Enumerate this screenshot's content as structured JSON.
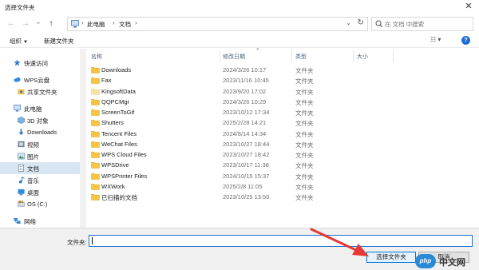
{
  "window": {
    "title": "选择文件夹",
    "close_glyph": "✕"
  },
  "address": {
    "back_glyph": "←",
    "forward_glyph": "→",
    "recent_glyph": "⌄",
    "up_glyph": "↑",
    "crumbs": [
      "此电脑",
      "文档"
    ],
    "sep_glyph": "›",
    "dropdown_glyph": "⌄",
    "refresh_glyph": "↻"
  },
  "search": {
    "placeholder": "在 文档 中搜索"
  },
  "toolbar": {
    "organize_label": "组织",
    "new_folder_label": "新建文件夹",
    "caret_glyph": "▼",
    "view_glyph": "☷ ▾",
    "help_glyph": "?"
  },
  "sidebar": {
    "items": [
      {
        "label": "快速访问",
        "icon": "star-icon"
      },
      {
        "label": "WPS云盘",
        "icon": "cloud-icon"
      },
      {
        "label": "共享文件夹",
        "icon": "shared-folder-icon"
      },
      {
        "label": "此电脑",
        "icon": "computer-icon"
      },
      {
        "label": "3D 对象",
        "icon": "cube-icon"
      },
      {
        "label": "Downloads",
        "icon": "download-icon"
      },
      {
        "label": "视频",
        "icon": "video-icon"
      },
      {
        "label": "图片",
        "icon": "picture-icon"
      },
      {
        "label": "文档",
        "icon": "document-icon",
        "selected": true
      },
      {
        "label": "音乐",
        "icon": "music-icon"
      },
      {
        "label": "桌面",
        "icon": "desktop-icon"
      },
      {
        "label": "OS (C:)",
        "icon": "drive-icon"
      },
      {
        "label": "网络",
        "icon": "network-icon"
      }
    ]
  },
  "columns": {
    "name": "名称",
    "date": "修改日期",
    "type": "类型",
    "size": "大小",
    "sort_glyph": "˄"
  },
  "files": [
    {
      "name": "Downloads",
      "date": "2024/3/26 10:17",
      "type": "文件夹"
    },
    {
      "name": "Fax",
      "date": "2023/11/16 10:45",
      "type": "文件夹"
    },
    {
      "name": "KingsoftData",
      "date": "2023/9/20 17:02",
      "type": "文件夹"
    },
    {
      "name": "QQPCMgr",
      "date": "2024/3/26 10:29",
      "type": "文件夹"
    },
    {
      "name": "ScreenToGif",
      "date": "2023/10/12 17:34",
      "type": "文件夹"
    },
    {
      "name": "Shutters",
      "date": "2025/2/28 14:21",
      "type": "文件夹"
    },
    {
      "name": "Tencent Files",
      "date": "2024/8/14 14:34",
      "type": "文件夹"
    },
    {
      "name": "WeChat Files",
      "date": "2023/10/27 18:44",
      "type": "文件夹"
    },
    {
      "name": "WPS Cloud Files",
      "date": "2023/10/27 18:42",
      "type": "文件夹"
    },
    {
      "name": "WPSDrive",
      "date": "2023/10/17 11:38",
      "type": "文件夹"
    },
    {
      "name": "WPSPrinter Files",
      "date": "2024/10/15 15:37",
      "type": "文件夹"
    },
    {
      "name": "WXWork",
      "date": "2025/2/8 11:05",
      "type": "文件夹"
    },
    {
      "name": "已扫描的文档",
      "date": "2023/10/25 13:50",
      "type": "文件夹"
    }
  ],
  "footer": {
    "folder_label": "文件夹:",
    "folder_value": "",
    "select_button": "选择文件夹",
    "cancel_button": "取消"
  },
  "watermark": {
    "badge": "php",
    "text": "中文网"
  },
  "colors": {
    "accent": "#0078d7",
    "folder": "#f6c544",
    "selection": "#d8e6f3",
    "arrow": "#e53935"
  }
}
